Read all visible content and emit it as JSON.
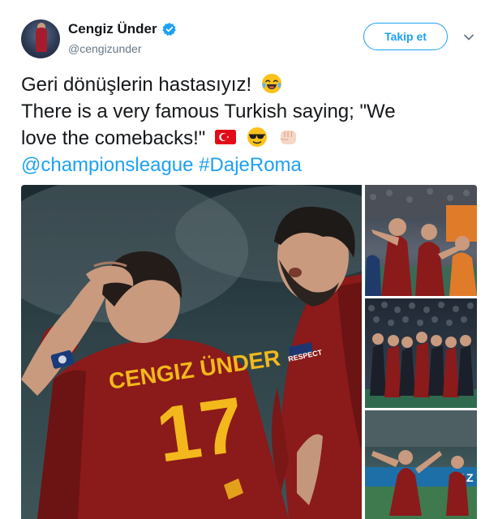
{
  "user": {
    "display_name": "Cengiz Ünder",
    "handle": "@cengizunder",
    "verified": true
  },
  "follow_button": {
    "label": "Takip et"
  },
  "menu": {
    "icon": "chevron-down-icon"
  },
  "tweet": {
    "line1": "Geri dönüşlerin hastasıyız!",
    "line2": "There is a very famous Turkish saying; \"We",
    "line3": "love the comebacks!\"",
    "mention": "@championsleague",
    "hashtag": "#DajeRoma",
    "emojis": [
      "face-with-tears-of-joy",
      "flag-turkey",
      "smiling-face-with-sunglasses",
      "oncoming-fist"
    ]
  },
  "media": {
    "main_photo": {
      "jersey_name": "CENGIZ ÜNDER",
      "jersey_number": "17",
      "sleeve_badge": "RESPECT"
    },
    "side_photo_3": {
      "board_text": "GAZ"
    }
  },
  "colors": {
    "accent": "#1da1f2",
    "text": "#14171a",
    "muted": "#657786",
    "jersey": "#8b1a1a",
    "jersey_text": "#f2b81c"
  }
}
